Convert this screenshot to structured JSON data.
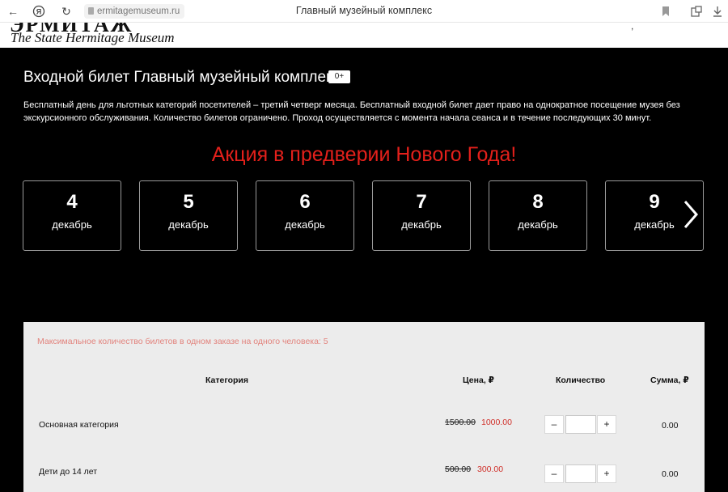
{
  "browser": {
    "url": "ermitagemuseum.ru",
    "tab_title": "Главный музейный комплекс",
    "icons": [
      "back-icon",
      "yandex-icon",
      "reload-icon",
      "lock-icon",
      "bookmark-icon",
      "extensions-icon",
      "download-icon"
    ]
  },
  "site": {
    "logo_subtitle": "The State Hermitage Museum"
  },
  "ticket": {
    "title": "Входной билет Главный музейный комплекс",
    "age_badge": "0+",
    "description": "Бесплатный день для льготных категорий посетителей – третий четверг месяца. Бесплатный входной билет дает право на однократное посещение музея без экскурсионного обслуживания. Количество билетов ограничено. Проход осуществляется с момента начала сеанса и в течение последующих 30 минут.",
    "promo": "Акция в предверии Нового Года!"
  },
  "dates": [
    {
      "day": "4",
      "month": "декабрь"
    },
    {
      "day": "5",
      "month": "декабрь"
    },
    {
      "day": "6",
      "month": "декабрь"
    },
    {
      "day": "7",
      "month": "декабрь"
    },
    {
      "day": "8",
      "month": "декабрь"
    },
    {
      "day": "9",
      "month": "декабрь"
    }
  ],
  "order": {
    "max_note": "Максимальное количество билетов в одном заказе на одного человека:  5",
    "headers": {
      "category": "Категория",
      "price": "Цена, ₽",
      "quantity": "Количество",
      "sum": "Сумма, ₽"
    },
    "rows": [
      {
        "category": "Основная категория",
        "old_price": "1500.00",
        "new_price": "1000.00",
        "minus": "–",
        "plus": "+",
        "quantity": "",
        "sum": "0.00"
      },
      {
        "category": "Дети до 14 лет",
        "old_price": "500.00",
        "new_price": "300.00",
        "minus": "–",
        "plus": "+",
        "quantity": "",
        "sum": "0.00"
      }
    ]
  },
  "colors": {
    "background": "#000000",
    "promo": "#e3201b",
    "panel": "#ececec",
    "note": "#e2837d",
    "sale_price": "#d0302a"
  }
}
